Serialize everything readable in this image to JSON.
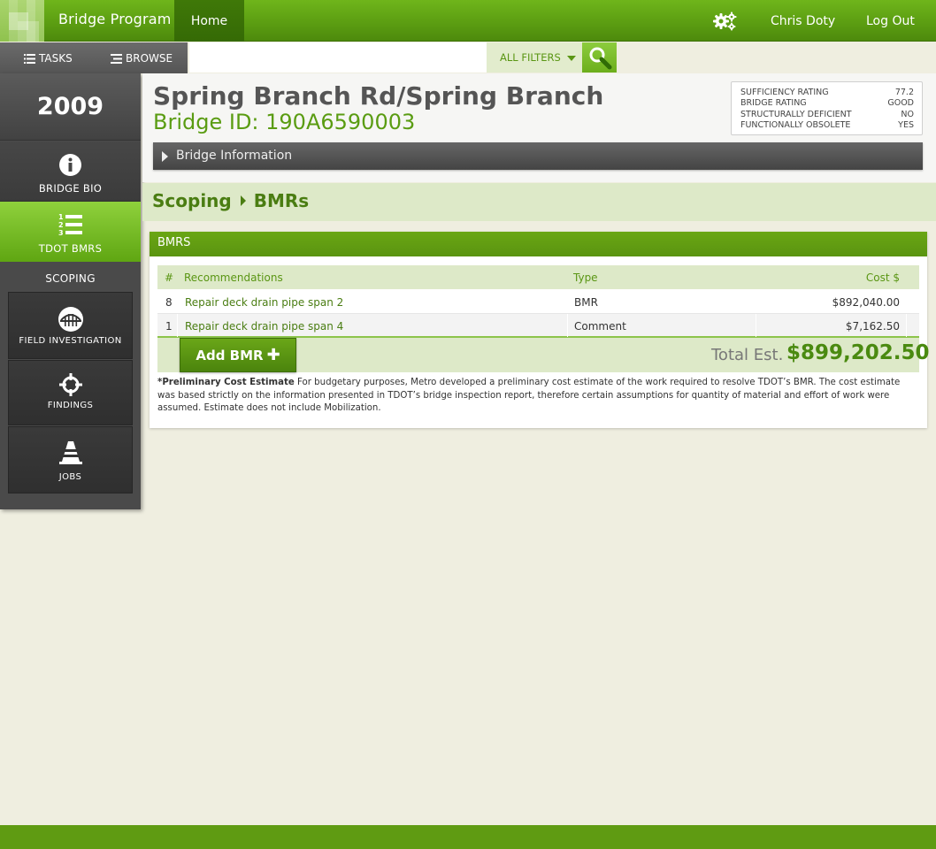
{
  "app": {
    "title": "Bridge Program",
    "nav_home": "Home",
    "user_name": "Chris Doty",
    "logout": "Log Out"
  },
  "toolbar": {
    "tasks": "TASKS",
    "browse": "BROWSE",
    "search_value": "",
    "filters": "ALL FILTERS"
  },
  "sidebar": {
    "year": "2009",
    "items": [
      {
        "label": "BRIDGE BIO",
        "icon": "info-icon"
      },
      {
        "label": "TDOT BMRS",
        "icon": "numbered-list-icon",
        "active": true
      }
    ],
    "section": "SCOPING",
    "tiles": [
      {
        "label": "FIELD INVESTIGATION",
        "icon": "bridge-icon"
      },
      {
        "label": "FINDINGS",
        "icon": "crosshair-icon"
      },
      {
        "label": "JOBS",
        "icon": "cone-icon"
      }
    ]
  },
  "bridge": {
    "name": "Spring Branch Rd/Spring Branch",
    "id": "Bridge ID: 190A6590003",
    "info_label": "Bridge Information"
  },
  "ratings": [
    {
      "label": "SUFFICIENCY RATING",
      "value": "77.2"
    },
    {
      "label": "BRIDGE RATING",
      "value": "GOOD"
    },
    {
      "label": "STRUCTURALLY DEFICIENT",
      "value": "NO"
    },
    {
      "label": "FUNCTIONALLY OBSOLETE",
      "value": "YES"
    }
  ],
  "breadcrumb": {
    "parent": "Scoping",
    "current": "BMRs"
  },
  "bmr_panel": {
    "title": "BMRS",
    "columns": {
      "num": "#",
      "rec": "Recommendations",
      "type": "Type",
      "cost": "Cost $"
    },
    "rows": [
      {
        "num": "8",
        "rec": "Repair deck drain pipe span 2",
        "type": "BMR",
        "cost": "$892,040.00"
      },
      {
        "num": "1",
        "rec": "Repair deck drain pipe span 4",
        "type": "Comment",
        "cost": "$7,162.50"
      }
    ],
    "add_label": "Add BMR",
    "add_plus": "✚",
    "total_label": "Total Est.",
    "total_value": "$899,202.50",
    "note_bold": "*Preliminary Cost Estimate",
    "note_text": " For budgetary purposes, Metro developed a preliminary cost estimate of the work required to resolve TDOT’s BMR. The cost estimate was based strictly on the information presented in TDOT’s bridge inspection report, therefore certain assumptions for quantity of material and effort of work were assumed. Estimate does not include Mobilization."
  },
  "colors": {
    "brand_green": "#5c9e12",
    "accent_light": "#dde9c8",
    "sidebar_dark": "#4a4a4a"
  }
}
